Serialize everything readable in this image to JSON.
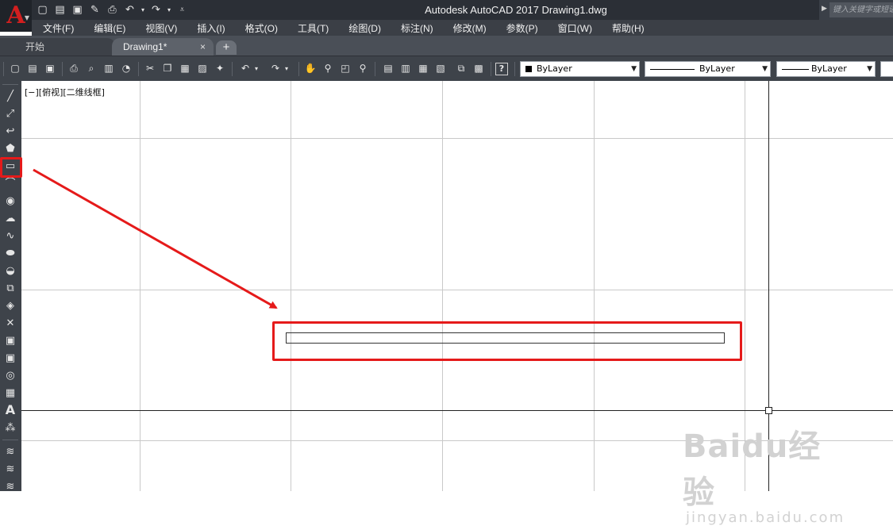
{
  "window": {
    "title": "Autodesk AutoCAD 2017    Drawing1.dwg",
    "app_letter": "A",
    "search_placeholder": "键入关键字或短语"
  },
  "menu": [
    "文件(F)",
    "编辑(E)",
    "视图(V)",
    "插入(I)",
    "格式(O)",
    "工具(T)",
    "绘图(D)",
    "标注(N)",
    "修改(M)",
    "参数(P)",
    "窗口(W)",
    "帮助(H)"
  ],
  "tabs": {
    "start": "开始",
    "drawing": "Drawing1*",
    "close": "×",
    "add": "+"
  },
  "toolbar": {
    "color_combo": "ByLayer",
    "linetype_combo": "ByLayer",
    "lineweight_combo": "ByLayer",
    "help": "?"
  },
  "canvas": {
    "viewport_label": "[−][俯视][二维线框]"
  },
  "draw_panel": {
    "text_tool": "A"
  },
  "watermark": {
    "brand": "Baidu经验",
    "url": "jingyan.baidu.com"
  },
  "colors": {
    "highlight": "#e51a1a",
    "app_red": "#d21f1f"
  }
}
